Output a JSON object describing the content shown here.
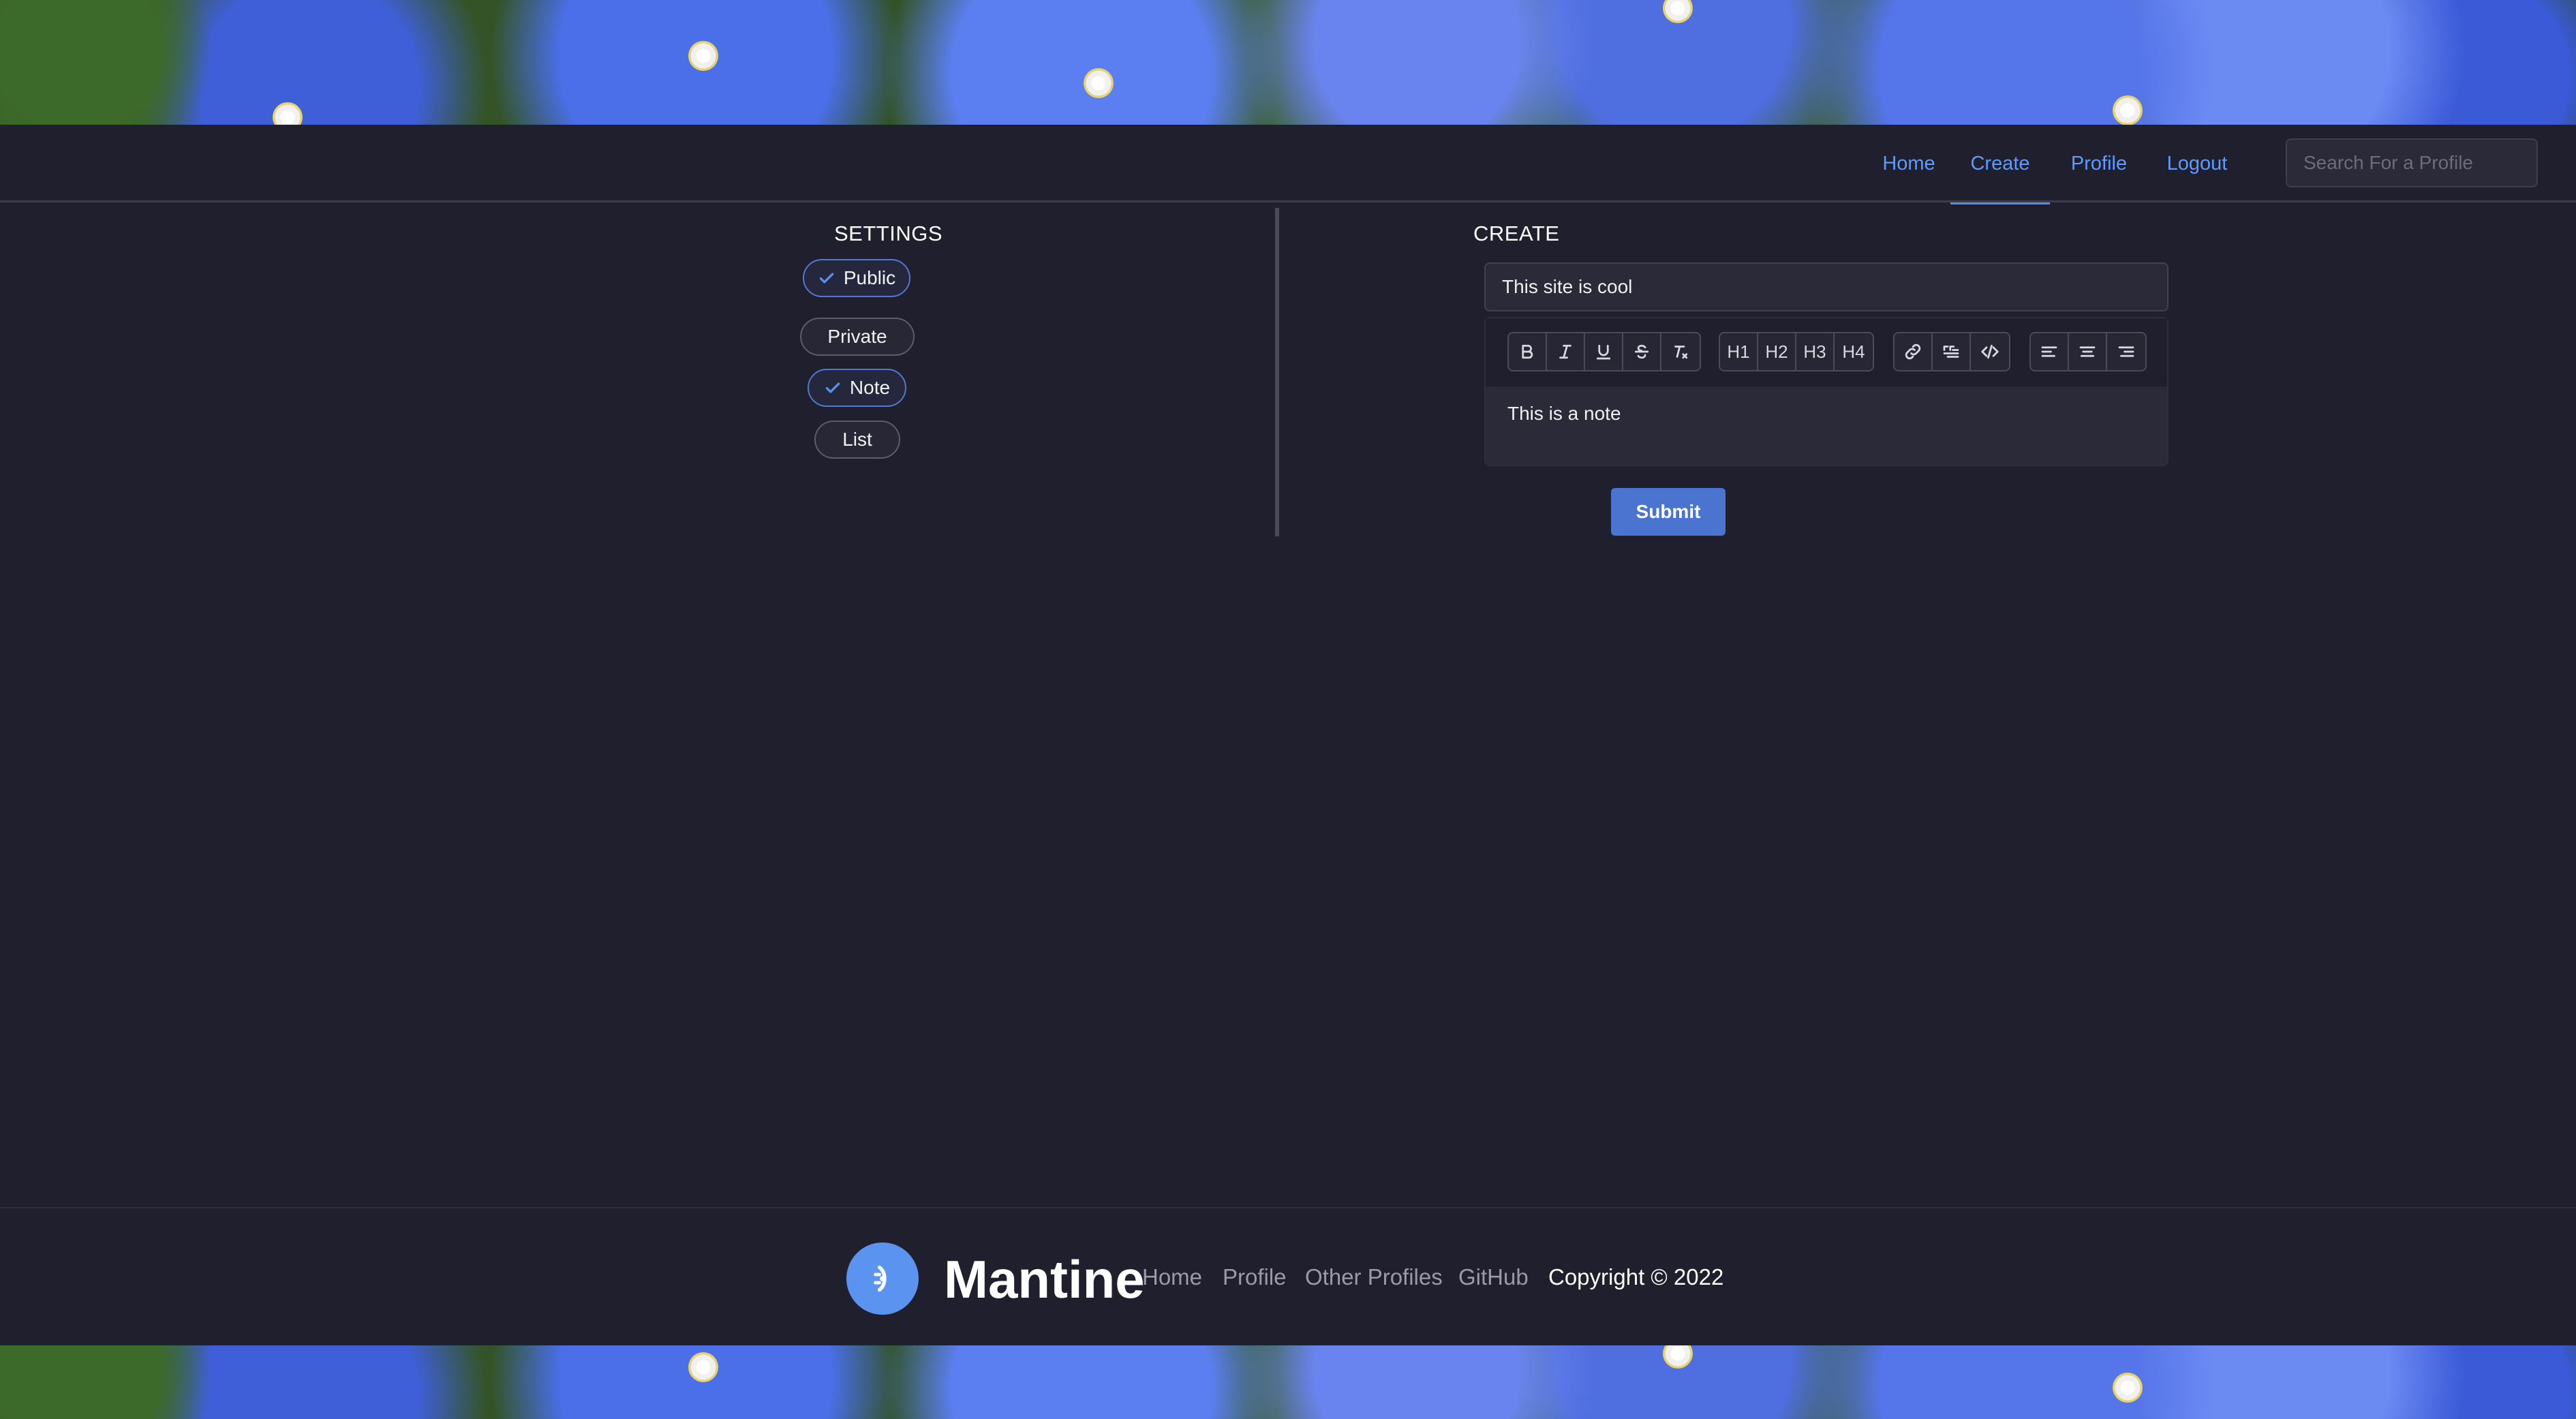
{
  "nav": {
    "items": [
      "Home",
      "Create",
      "Profile",
      "Logout"
    ],
    "active": "Create",
    "search_placeholder": "Search For a Profile"
  },
  "settings": {
    "title": "SETTINGS",
    "visibility": [
      {
        "label": "Public",
        "checked": true
      },
      {
        "label": "Private",
        "checked": false
      }
    ],
    "type": [
      {
        "label": "Note",
        "checked": true
      },
      {
        "label": "List",
        "checked": false
      }
    ]
  },
  "create": {
    "title": "CREATE",
    "title_value": "This site is cool",
    "content_value": "This is a note",
    "toolbar_groups": [
      [
        "bold-icon",
        "italic-icon",
        "underline-icon",
        "strikethrough-icon",
        "clear-format-icon"
      ],
      [
        "H1",
        "H2",
        "H3",
        "H4"
      ],
      [
        "link-icon",
        "blockquote-icon",
        "code-icon"
      ],
      [
        "align-left-icon",
        "align-center-icon",
        "align-right-icon"
      ]
    ],
    "submit_label": "Submit"
  },
  "footer": {
    "brand": "Mantine",
    "links": [
      "Home",
      "Profile",
      "Other Profiles",
      "GitHub"
    ],
    "copyright": "Copyright © 2022"
  },
  "colors": {
    "background": "#1f1f2e",
    "accent": "#5c9bff",
    "button": "#4a74cf",
    "logo": "#5b93f0"
  }
}
